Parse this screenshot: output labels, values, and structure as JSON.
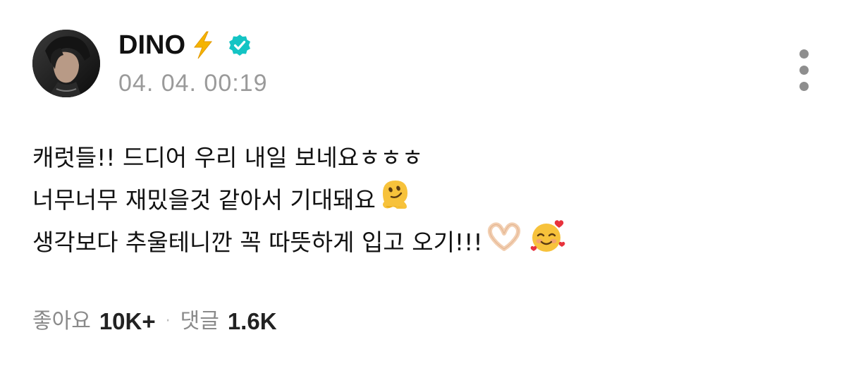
{
  "post": {
    "author": {
      "name": "DINO",
      "verified": true,
      "name_emoji": "lightning-icon",
      "verified_color": "#14c4c4"
    },
    "timestamp": "04. 04. 00:19",
    "body_lines": [
      {
        "text": "캐럿들!! 드디어 우리 내일 보네요ㅎㅎㅎ",
        "emoji": []
      },
      {
        "text": "너무너무 재밌을것 같아서 기대돼요",
        "emoji": [
          "melting-face-icon"
        ]
      },
      {
        "text": "생각보다 추울테니깐 꼭 따뜻하게 입고 오기!!!",
        "emoji": [
          "heart-hands-icon",
          "smiling-face-with-hearts-icon"
        ]
      }
    ],
    "stats": {
      "likes_label": "좋아요",
      "likes_value": "10K+",
      "separator": "·",
      "comments_label": "댓글",
      "comments_value": "1.6K"
    }
  },
  "colors": {
    "text": "#111111",
    "muted": "#9a9a9a",
    "accent": "#14c4c4",
    "lightning": "#f5b400"
  }
}
